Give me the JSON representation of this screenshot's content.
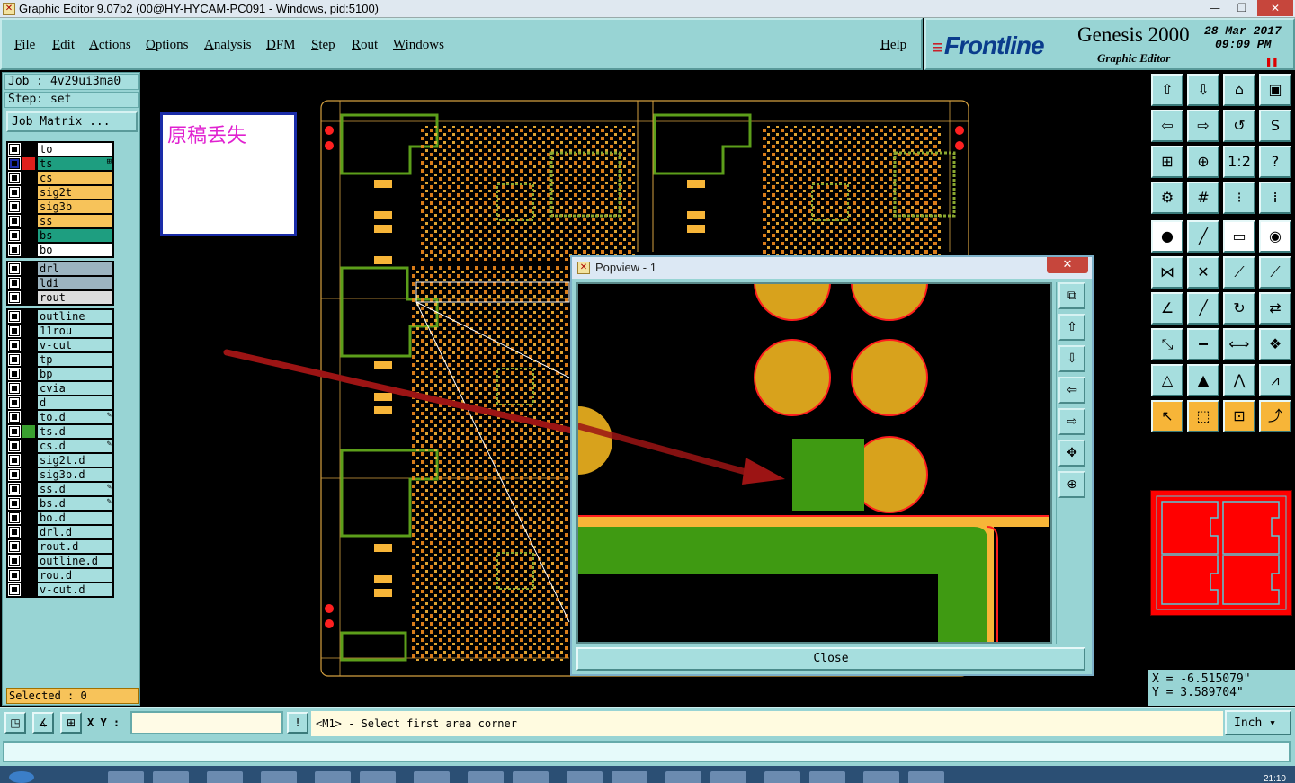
{
  "window": {
    "title": "Graphic Editor 9.07b2 (00@HY-HYCAM-PC091 - Windows, pid:5100)",
    "min": "—",
    "max": "❐",
    "close": "✕"
  },
  "menu": [
    "File",
    "Edit",
    "Actions",
    "Options",
    "Analysis",
    "DFM",
    "Step",
    "Rout",
    "Windows"
  ],
  "help": "Help",
  "brand": {
    "logo": "Frontline",
    "product": "Genesis 2000",
    "subtitle": "Graphic Editor",
    "date": "28 Mar 2017",
    "time": "09:09 PM"
  },
  "job": {
    "job": "Job : 4v29ui3ma0",
    "step": "Step: set",
    "matrix": "Job Matrix ..."
  },
  "layers_board": [
    {
      "name": "to",
      "color": "#ffffff",
      "swatch": "#000000"
    },
    {
      "name": "ts",
      "color": "#1e9e80",
      "swatch": "#e0201c",
      "active": true,
      "tag": "⊞"
    },
    {
      "name": "cs",
      "color": "#f7c35a",
      "swatch": "#000000"
    },
    {
      "name": "sig2t",
      "color": "#f7c35a",
      "swatch": "#000000"
    },
    {
      "name": "sig3b",
      "color": "#f7c35a",
      "swatch": "#000000"
    },
    {
      "name": "ss",
      "color": "#f7c35a",
      "swatch": "#000000"
    },
    {
      "name": "bs",
      "color": "#1e9e80",
      "swatch": "#000000"
    },
    {
      "name": "bo",
      "color": "#ffffff",
      "swatch": "#000000"
    }
  ],
  "layers_drill": [
    {
      "name": "drl",
      "color": "#9cb4c0",
      "swatch": "#000000"
    },
    {
      "name": "ldi",
      "color": "#9cb4c0",
      "swatch": "#000000"
    },
    {
      "name": "rout",
      "color": "#dddddd",
      "swatch": "#000000"
    }
  ],
  "layers_misc": [
    {
      "name": "outline",
      "color": "#a6dede",
      "swatch": "#000000"
    },
    {
      "name": "11rou",
      "color": "#a6dede",
      "swatch": "#000000"
    },
    {
      "name": "v-cut",
      "color": "#a6dede",
      "swatch": "#000000"
    },
    {
      "name": "tp",
      "color": "#a6dede",
      "swatch": "#000000"
    },
    {
      "name": "bp",
      "color": "#a6dede",
      "swatch": "#000000"
    },
    {
      "name": "cvia",
      "color": "#a6dede",
      "swatch": "#000000"
    },
    {
      "name": "d",
      "color": "#a6dede",
      "swatch": "#000000"
    },
    {
      "name": "to.d",
      "color": "#a6dede",
      "swatch": "#000000",
      "tag": "✎"
    },
    {
      "name": "ts.d",
      "color": "#a6dede",
      "swatch": "#3aa030"
    },
    {
      "name": "cs.d",
      "color": "#a6dede",
      "swatch": "#000000",
      "tag": "✎"
    },
    {
      "name": "sig2t.d",
      "color": "#a6dede",
      "swatch": "#000000"
    },
    {
      "name": "sig3b.d",
      "color": "#a6dede",
      "swatch": "#000000"
    },
    {
      "name": "ss.d",
      "color": "#a6dede",
      "swatch": "#000000",
      "tag": "✎"
    },
    {
      "name": "bs.d",
      "color": "#a6dede",
      "swatch": "#000000",
      "tag": "✎"
    },
    {
      "name": "bo.d",
      "color": "#a6dede",
      "swatch": "#000000"
    },
    {
      "name": "drl.d",
      "color": "#a6dede",
      "swatch": "#000000"
    },
    {
      "name": "rout.d",
      "color": "#a6dede",
      "swatch": "#000000"
    },
    {
      "name": "outline.d",
      "color": "#a6dede",
      "swatch": "#000000"
    },
    {
      "name": "rou.d",
      "color": "#a6dede",
      "swatch": "#000000"
    },
    {
      "name": "v-cut.d",
      "color": "#a6dede",
      "swatch": "#000000"
    }
  ],
  "selected": "Selected : 0",
  "note": "原稿丢失",
  "popview": {
    "title": "Popview - 1",
    "close_x": "✕",
    "close_button": "Close"
  },
  "coords": {
    "x": "X = -6.515079\"",
    "y": "Y = 3.589704\""
  },
  "command": {
    "xy_label": "X Y :",
    "xy_value": "",
    "prompt": "<M1> - Select first area corner",
    "units": "Inch ▾"
  },
  "clock": "21:10",
  "colors": {
    "panel": "#98d4d4",
    "copper": "#f7b538",
    "mask": "#3f9a12",
    "pad": "#d8a21c",
    "outline": "#ff1e1e"
  }
}
